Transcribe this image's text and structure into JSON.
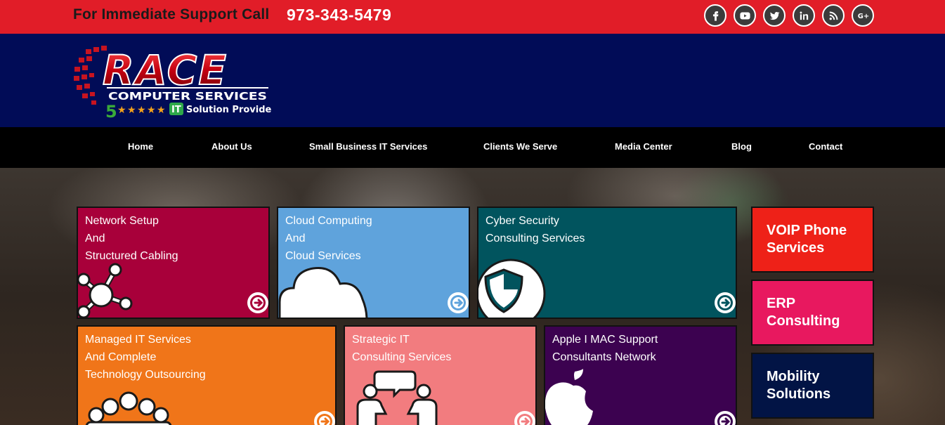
{
  "topbar": {
    "support_label": "For Immediate Support Call",
    "phone": "973-343-5479",
    "socials": [
      "facebook-icon",
      "youtube-icon",
      "twitter-icon",
      "linkedin-icon",
      "rss-icon",
      "google-plus-icon"
    ]
  },
  "logo": {
    "name": "RACE",
    "sub": "COMPUTER SERVICES",
    "rating_number": "5",
    "badge": "IT",
    "tagline": "Solution Provider"
  },
  "nav": {
    "items": [
      "Home",
      "About Us",
      "Small Business IT Services",
      "Clients We Serve",
      "Media Center",
      "Blog",
      "Contact"
    ]
  },
  "tiles": [
    {
      "lines": [
        "Network Setup",
        "And",
        "Structured Cabling"
      ],
      "color": "#a8003a",
      "icon": "network-icon"
    },
    {
      "lines": [
        "Cloud Computing",
        "And",
        "Cloud Services"
      ],
      "color": "#5fa3dc",
      "icon": "cloud-icon"
    },
    {
      "lines": [
        "Cyber Security",
        "Consulting Services"
      ],
      "color": "#01545e",
      "icon": "shield-icon"
    },
    {
      "lines": [
        "Managed IT Services",
        "And Complete",
        "Technology Outsourcing"
      ],
      "color": "#f07519",
      "icon": "group-icon"
    },
    {
      "lines": [
        "Strategic IT",
        "Consulting Services"
      ],
      "color": "#f27c7f",
      "icon": "consulting-icon"
    },
    {
      "lines": [
        "Apple I MAC Support",
        "Consultants Network"
      ],
      "color": "#3c0250",
      "icon": "apple-icon"
    }
  ],
  "side": [
    {
      "lines": [
        "VOIP Phone",
        "Services"
      ],
      "color": "#ee2118"
    },
    {
      "lines": [
        "ERP",
        "Consulting"
      ],
      "color": "#e8185f"
    },
    {
      "lines": [
        "Mobility",
        "Solutions"
      ],
      "color": "#021445"
    }
  ]
}
